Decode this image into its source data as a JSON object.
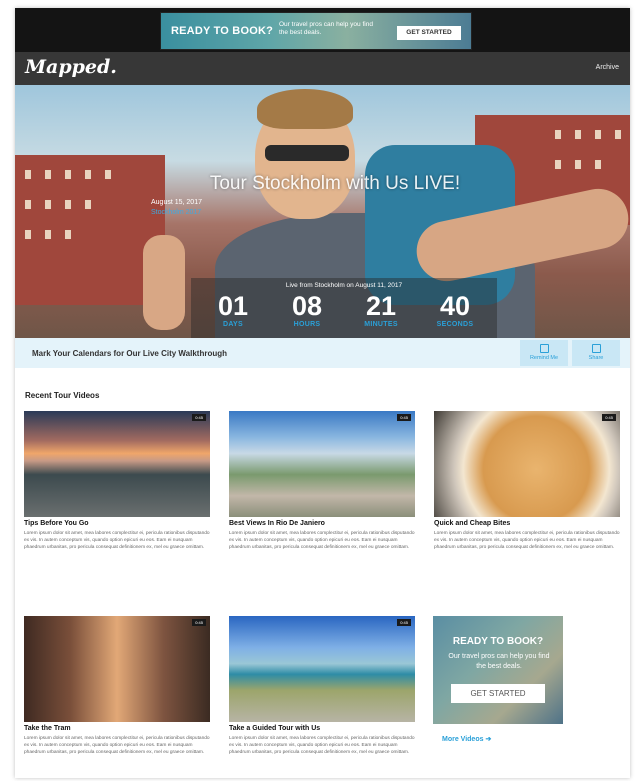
{
  "banner": {
    "title": "READY TO BOOK?",
    "subtitle": "Our travel pros can help you find the best deals.",
    "button": "GET STARTED"
  },
  "nav": {
    "logo": "Mapped.",
    "archive": "Archive"
  },
  "hero": {
    "title": "Tour Stockholm with Us LIVE!",
    "date": "August 15, 2017",
    "link": "Stockholm 2017",
    "countdown_caption": "Live from Stockholm on August 11, 2017",
    "countdown": [
      {
        "value": "01",
        "label": "DAYS"
      },
      {
        "value": "08",
        "label": "HOURS"
      },
      {
        "value": "21",
        "label": "MINUTES"
      },
      {
        "value": "40",
        "label": "SECONDS"
      }
    ]
  },
  "calendar": {
    "text": "Mark Your Calendars for Our Live City Walkthrough",
    "remind": "Remind Me",
    "share": "Share"
  },
  "section_title": "Recent Tour Videos",
  "cards": [
    {
      "title": "Tips Before You Go",
      "duration": "0:45",
      "desc": "Lorem ipsum dolor sit amet, mea labores complectitur ei, pericula rationibus disputando ex vis. In autem conceptum vis, quando option epicuri eu eos. Eam ei nusquam phaedrum urbanitas, pro pericula consequat definitionem ex, mel eu graece omittam."
    },
    {
      "title": "Best Views In Rio De Janiero",
      "duration": "0:45",
      "desc": "Lorem ipsum dolor sit amet, mea labores complectitur ei, pericula rationibus disputando ex vis. In autem conceptum vis, quando option epicuri eu eos. Eam ei nusquam phaedrum urbanitas, pro pericula consequat definitionem ex, mel eu graece omittam."
    },
    {
      "title": "Quick and Cheap Bites",
      "duration": "0:45",
      "desc": "Lorem ipsum dolor sit amet, mea labores complectitur ei, pericula rationibus disputando ex vis. In autem conceptum vis, quando option epicuri eu eos. Eam ei nusquam phaedrum urbanitas, pro pericula consequat definitionem ex, mel eu graece omittam."
    },
    {
      "title": "Take the Tram",
      "duration": "0:45",
      "desc": "Lorem ipsum dolor sit amet, mea labores complectitur ei, pericula rationibus disputando ex vis. In autem conceptum vis, quando option epicuri eu eos. Eam ei nusquam phaedrum urbanitas, pro pericula consequat definitionem ex, mel eu graece omittam."
    },
    {
      "title": "Take a Guided Tour with Us",
      "duration": "0:45",
      "desc": "Lorem ipsum dolor sit amet, mea labores complectitur ei, pericula rationibus disputando ex vis. In autem conceptum vis, quando option epicuri eu eos. Eam ei nusquam phaedrum urbanitas, pro pericula consequat definitionem ex, mel eu graece omittam."
    }
  ],
  "promo": {
    "title": "READY TO BOOK?",
    "subtitle": "Our travel pros can help you find the best deals.",
    "button": "GET STARTED"
  },
  "more_videos": "More Videos ➔",
  "colors": {
    "accent": "#2aa0d8",
    "nav_bg": "#373737",
    "calendar_bg": "#e4f3fa"
  }
}
